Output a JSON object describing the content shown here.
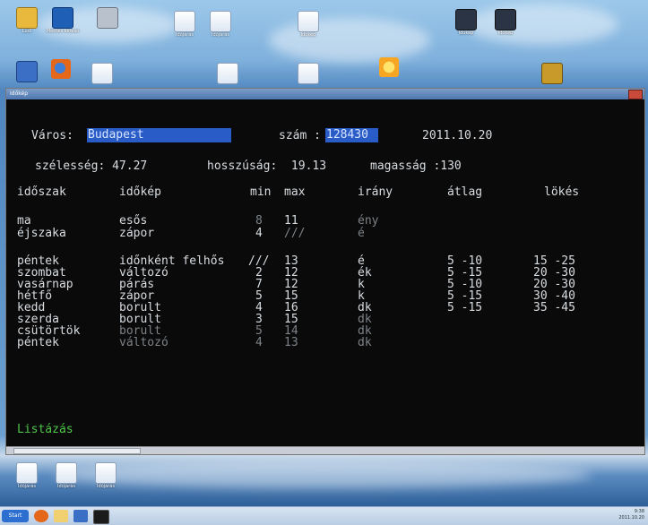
{
  "desktop": {
    "row1": [
      {
        "name": "Ludi",
        "label": "Ludi",
        "icon": "doc-icon"
      },
      {
        "name": "Mentes",
        "label": "Mentés kereső",
        "icon": "save-icon"
      },
      {
        "name": "Doc",
        "label": "",
        "icon": "doc-icon"
      },
      {
        "name": "A",
        "label": "Időjárás",
        "icon": "doc-icon"
      },
      {
        "name": "B",
        "label": "Időjárás",
        "icon": "doc-icon"
      },
      {
        "name": "C",
        "label": "Idokep",
        "icon": "doc-icon"
      },
      {
        "name": "D",
        "label": "Idokep",
        "icon": "app-icon"
      },
      {
        "name": "E",
        "label": "Idokep",
        "icon": "app-icon"
      }
    ],
    "row2": [
      {
        "name": "net",
        "label": "",
        "icon": "network-icon"
      },
      {
        "name": "firefox",
        "label": "",
        "icon": "firefox-icon"
      },
      {
        "name": "files",
        "label": "",
        "icon": "doc-icon"
      },
      {
        "name": "w1",
        "label": "",
        "icon": "doc-icon"
      },
      {
        "name": "w2",
        "label": "",
        "icon": "doc-icon"
      },
      {
        "name": "sun",
        "label": "",
        "icon": "weather-icon"
      },
      {
        "name": "pin",
        "label": "",
        "icon": "app-icon"
      }
    ],
    "row3": [
      {
        "name": "x1",
        "label": "Időjárás",
        "icon": "doc-icon"
      },
      {
        "name": "x2",
        "label": "Időjárás",
        "icon": "doc-icon"
      },
      {
        "name": "x3",
        "label": "Időjárás",
        "icon": "doc-icon"
      }
    ]
  },
  "window": {
    "title": "Időkép"
  },
  "header": {
    "varos_label": "Város:",
    "varos_value": "Budapest",
    "szam_label": "szám :",
    "szam_value": "128430",
    "date": "2011.10.20",
    "szelesseg": "szélesség: 47.27",
    "hosszusag": "hosszúság:  19.13",
    "magassag": "magasság :130"
  },
  "table": {
    "columns": [
      "időszak",
      "időkép",
      "min",
      "max",
      "irány",
      "átlag",
      "lökés"
    ],
    "today": [
      {
        "period": "ma",
        "sky": "esős",
        "min": "8",
        "max": "11",
        "dir": "ény",
        "avg": "",
        "gust": ""
      },
      {
        "period": "éjszaka",
        "sky": "zápor",
        "min": "4",
        "max": "///",
        "dir": "é",
        "avg": "",
        "gust": ""
      }
    ],
    "days": [
      {
        "period": "péntek",
        "sky": "időnként felhős",
        "min": "///",
        "max": "13",
        "dir": "é",
        "avg": "5 -10",
        "gust": "15 -25"
      },
      {
        "period": "szombat",
        "sky": "változó",
        "min": "2",
        "max": "12",
        "dir": "ék",
        "avg": "5 -15",
        "gust": "20 -30"
      },
      {
        "period": "vasárnap",
        "sky": "párás",
        "min": "7",
        "max": "12",
        "dir": "k",
        "avg": "5 -10",
        "gust": "20 -30"
      },
      {
        "period": "hétfő",
        "sky": "zápor",
        "min": "5",
        "max": "15",
        "dir": "k",
        "avg": "5 -15",
        "gust": "30 -40"
      },
      {
        "period": "kedd",
        "sky": "borult",
        "min": "4",
        "max": "16",
        "dir": "dk",
        "avg": "5 -15",
        "gust": "35 -45"
      },
      {
        "period": "szerda",
        "sky": "borult",
        "min": "3",
        "max": "15",
        "dir": "dk",
        "avg": "",
        "gust": ""
      },
      {
        "period": "csütörtök",
        "sky": "borult",
        "min": "5",
        "max": "14",
        "dir": "dk",
        "avg": "",
        "gust": ""
      },
      {
        "period": "péntek",
        "sky": "változó",
        "min": "4",
        "max": "13",
        "dir": "dk",
        "avg": "",
        "gust": ""
      }
    ]
  },
  "footer": {
    "listazas": "Listázás"
  },
  "taskbar": {
    "start": "Start",
    "clock_time": "9:38",
    "clock_date": "2011.10.20"
  }
}
